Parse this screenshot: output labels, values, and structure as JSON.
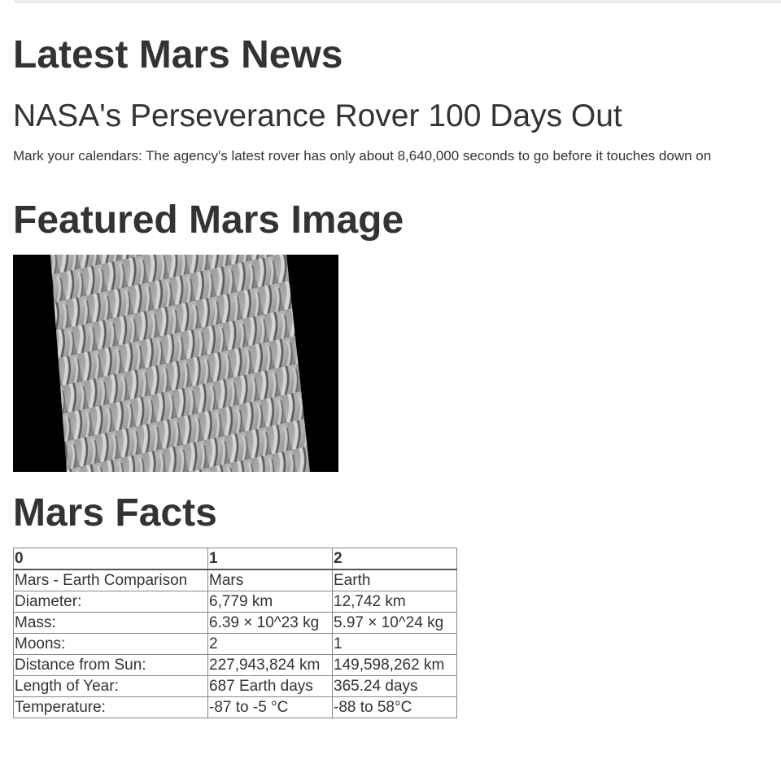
{
  "news": {
    "heading": "Latest Mars News",
    "title": "NASA's Perseverance Rover 100 Days Out",
    "teaser": "Mark your calendars: The agency's latest rover has only about 8,640,000 seconds to go before it touches down on"
  },
  "featured": {
    "heading": "Featured Mars Image"
  },
  "facts": {
    "heading": "Mars Facts",
    "columns": [
      "0",
      "1",
      "2"
    ],
    "rows": [
      [
        "Mars - Earth Comparison",
        "Mars",
        "Earth"
      ],
      [
        "Diameter:",
        "6,779 km",
        "12,742 km"
      ],
      [
        "Mass:",
        "6.39 × 10^23 kg",
        "5.97 × 10^24 kg"
      ],
      [
        "Moons:",
        "2",
        "1"
      ],
      [
        "Distance from Sun:",
        "227,943,824 km",
        "149,598,262 km"
      ],
      [
        "Length of Year:",
        "687 Earth days",
        "365.24 days"
      ],
      [
        "Temperature:",
        "-87 to -5 °C",
        "-88 to 58°C"
      ]
    ]
  }
}
